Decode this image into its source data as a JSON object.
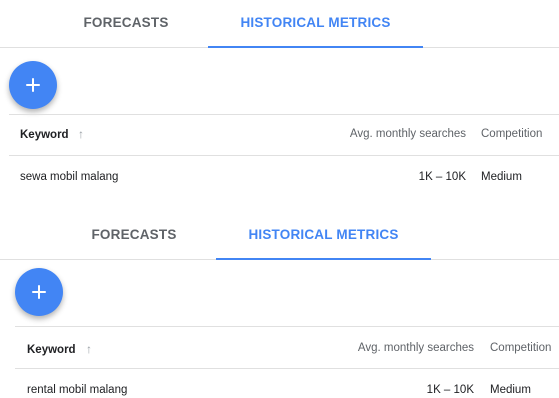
{
  "panels": [
    {
      "tabs": {
        "forecasts": "FORECASTS",
        "historical": "HISTORICAL METRICS"
      },
      "add_icon": "plus-icon",
      "table": {
        "headers": {
          "keyword": "Keyword",
          "avg_monthly_searches": "Avg. monthly searches",
          "competition": "Competition"
        },
        "sort_icon": "↑",
        "rows": [
          {
            "keyword": "sewa mobil malang",
            "avg_monthly_searches": "1K – 10K",
            "competition": "Medium"
          }
        ]
      }
    },
    {
      "tabs": {
        "forecasts": "FORECASTS",
        "historical": "HISTORICAL METRICS"
      },
      "add_icon": "plus-icon",
      "table": {
        "headers": {
          "keyword": "Keyword",
          "avg_monthly_searches": "Avg. monthly searches",
          "competition": "Competition"
        },
        "sort_icon": "↑",
        "rows": [
          {
            "keyword": "rental mobil malang",
            "avg_monthly_searches": "1K – 10K",
            "competition": "Medium"
          }
        ]
      }
    }
  ],
  "colors": {
    "accent": "#4285f4",
    "text": "#202124",
    "muted": "#5f6368",
    "divider": "#e0e0e0"
  }
}
